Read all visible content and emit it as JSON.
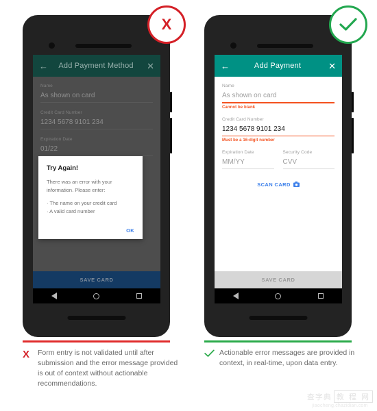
{
  "left": {
    "badge": {
      "icon": "x-mark-icon",
      "glyph": "X",
      "color": "#d42027"
    },
    "appbar": {
      "back_icon": "←",
      "title": "Add Payment Method",
      "close_icon": "✕"
    },
    "form": {
      "name": {
        "label": "Name",
        "value": "As shown on card"
      },
      "card": {
        "label": "Credit Card Number",
        "value": "1234 5678 9101 234"
      },
      "exp": {
        "label": "Expiration Date",
        "value": "01/22"
      }
    },
    "dialog": {
      "title": "Try Again!",
      "body": "There was an error with your information. Please enter:",
      "bullets": [
        "· The name on your credit card",
        "· A valid card number"
      ],
      "ok_label": "OK"
    },
    "save_label": "SAVE CARD",
    "divider_color": "#e02b2b",
    "caption": "Form entry is not validated until after submission and the error message provided is out of context without actionable recommendations."
  },
  "right": {
    "badge": {
      "icon": "check-mark-icon",
      "color": "#22a74f"
    },
    "appbar": {
      "back_icon": "←",
      "title": "Add Payment",
      "close_icon": "✕"
    },
    "form": {
      "name": {
        "label": "Name",
        "placeholder": "As shown on card",
        "error": "Cannot be blank"
      },
      "card": {
        "label": "Credit Card Number",
        "value": "1234 5678 9101 234",
        "error": "Must be a 16-digit number"
      },
      "exp": {
        "label": "Expiration Date",
        "placeholder": "MM/YY"
      },
      "cvv": {
        "label": "Security Code",
        "placeholder": "CVV"
      },
      "scan_label": "SCAN CARD",
      "scan_icon": "📷"
    },
    "save_label": "SAVE CARD",
    "divider_color": "#2aaa4a",
    "caption": "Actionable error messages are provided in context, in real-time, upon data entry."
  },
  "navbar": {
    "back": "nav-back-icon",
    "home": "nav-home-icon",
    "recent": "nav-recent-icon"
  },
  "watermark": {
    "brand1": "查字典",
    "brand2": "教 程 网",
    "url": "jiaocheng.chazidian.com"
  }
}
